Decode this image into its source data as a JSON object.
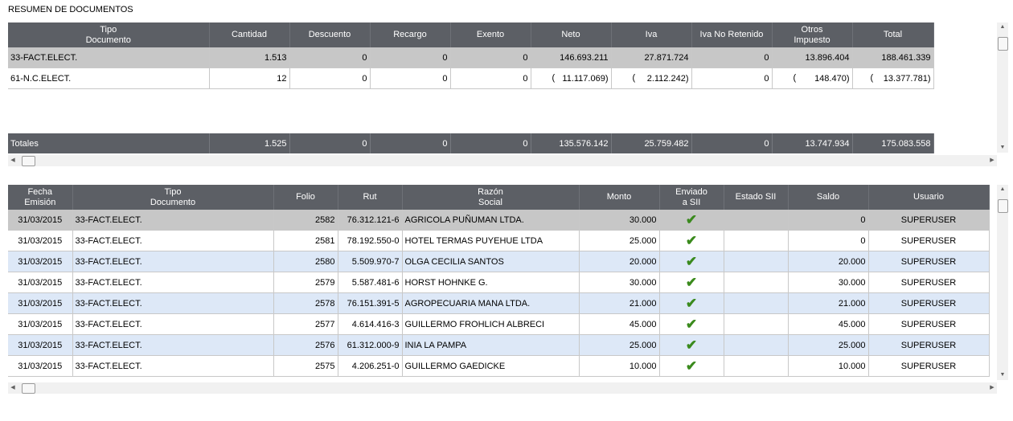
{
  "title": "RESUMEN DE DOCUMENTOS",
  "summary": {
    "headers": [
      "Tipo\nDocumento",
      "Cantidad",
      "Descuento",
      "Recargo",
      "Exento",
      "Neto",
      "Iva",
      "Iva No Retenido",
      "Otros\nImpuesto",
      "Total"
    ],
    "rows": [
      {
        "tipo": "33-FACT.ELECT.",
        "cantidad": "1.513",
        "descuento": "0",
        "recargo": "0",
        "exento": "0",
        "neto": "146.693.211",
        "iva": "27.871.724",
        "iva_no_ret": "0",
        "otros": "13.896.404",
        "total": "188.461.339"
      },
      {
        "tipo": "61-N.C.ELECT.",
        "cantidad": "12",
        "descuento": "0",
        "recargo": "0",
        "exento": "0",
        "neto": "11.117.069)",
        "iva": "2.112.242)",
        "iva_no_ret": "0",
        "otros": "148.470)",
        "total": "13.377.781)"
      }
    ],
    "open_paren": "(",
    "totals": {
      "label": "Totales",
      "cantidad": "1.525",
      "descuento": "0",
      "recargo": "0",
      "exento": "0",
      "neto": "135.576.142",
      "iva": "25.759.482",
      "iva_no_ret": "0",
      "otros": "13.747.934",
      "total": "175.083.558"
    }
  },
  "detail": {
    "headers": [
      "Fecha\nEmisión",
      "Tipo\nDocumento",
      "Folio",
      "Rut",
      "Razón\nSocial",
      "Monto",
      "Enviado\na SII",
      "Estado SII",
      "Saldo",
      "Usuario"
    ],
    "rows": [
      {
        "fecha": "31/03/2015",
        "tipo": "33-FACT.ELECT.",
        "folio": "2582",
        "rut": "76.312.121-6",
        "razon": "AGRICOLA PUÑUMAN  LTDA.",
        "monto": "30.000",
        "enviado": "✔",
        "estado": "",
        "saldo": "0",
        "usuario": "SUPERUSER"
      },
      {
        "fecha": "31/03/2015",
        "tipo": "33-FACT.ELECT.",
        "folio": "2581",
        "rut": "78.192.550-0",
        "razon": "HOTEL TERMAS PUYEHUE LTDA",
        "monto": "25.000",
        "enviado": "✔",
        "estado": "",
        "saldo": "0",
        "usuario": "SUPERUSER"
      },
      {
        "fecha": "31/03/2015",
        "tipo": "33-FACT.ELECT.",
        "folio": "2580",
        "rut": "5.509.970-7",
        "razon": "OLGA CECILIA SANTOS",
        "monto": "20.000",
        "enviado": "✔",
        "estado": "",
        "saldo": "20.000",
        "usuario": "SUPERUSER"
      },
      {
        "fecha": "31/03/2015",
        "tipo": "33-FACT.ELECT.",
        "folio": "2579",
        "rut": "5.587.481-6",
        "razon": "HORST HOHNKE G.",
        "monto": "30.000",
        "enviado": "✔",
        "estado": "",
        "saldo": "30.000",
        "usuario": "SUPERUSER"
      },
      {
        "fecha": "31/03/2015",
        "tipo": "33-FACT.ELECT.",
        "folio": "2578",
        "rut": "76.151.391-5",
        "razon": "AGROPECUARIA MANA LTDA.",
        "monto": "21.000",
        "enviado": "✔",
        "estado": "",
        "saldo": "21.000",
        "usuario": "SUPERUSER"
      },
      {
        "fecha": "31/03/2015",
        "tipo": "33-FACT.ELECT.",
        "folio": "2577",
        "rut": "4.614.416-3",
        "razon": "GUILLERMO FROHLICH ALBRECI",
        "monto": "45.000",
        "enviado": "✔",
        "estado": "",
        "saldo": "45.000",
        "usuario": "SUPERUSER"
      },
      {
        "fecha": "31/03/2015",
        "tipo": "33-FACT.ELECT.",
        "folio": "2576",
        "rut": "61.312.000-9",
        "razon": "INIA LA PAMPA",
        "monto": "25.000",
        "enviado": "✔",
        "estado": "",
        "saldo": "25.000",
        "usuario": "SUPERUSER"
      },
      {
        "fecha": "31/03/2015",
        "tipo": "33-FACT.ELECT.",
        "folio": "2575",
        "rut": "4.206.251-0",
        "razon": "GUILLERMO GAEDICKE",
        "monto": "10.000",
        "enviado": "✔",
        "estado": "",
        "saldo": "10.000",
        "usuario": "SUPERUSER"
      }
    ]
  },
  "icons": {
    "check": "checkmark-icon",
    "up": "scroll-up-arrow-icon",
    "down": "scroll-down-arrow-icon",
    "left": "scroll-left-arrow-icon",
    "right": "scroll-right-arrow-icon"
  },
  "glyphs": {
    "up": "▲",
    "down": "▼",
    "left": "◀",
    "right": "▶"
  },
  "colors": {
    "header_bg": "#5c5f65",
    "selected_row": "#c7c7c7",
    "alt_row": "#dde8f7",
    "check": "#3a8a1d"
  }
}
